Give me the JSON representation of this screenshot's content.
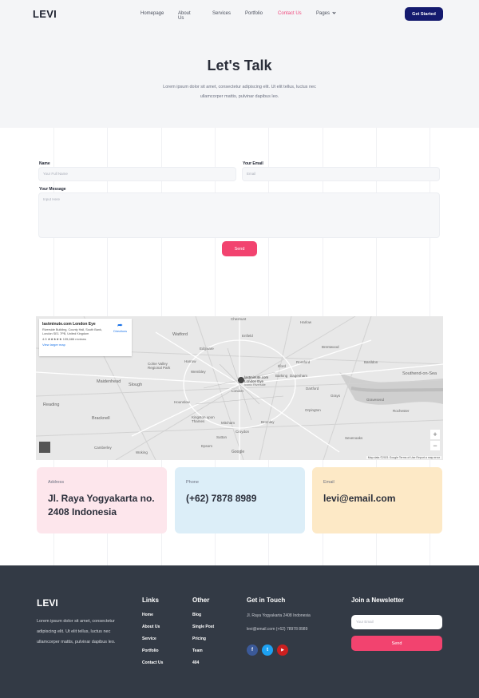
{
  "header": {
    "logo": "LEVI",
    "nav": [
      {
        "label": "Homepage"
      },
      {
        "label": "About Us"
      },
      {
        "label": "Services"
      },
      {
        "label": "Portfolio"
      },
      {
        "label": "Contact Us",
        "active": true
      },
      {
        "label": "Pages"
      }
    ],
    "cta_label": "Get Started",
    "accent": "#f0477c",
    "cta_color": "#141a6e"
  },
  "hero": {
    "title": "Let's Talk",
    "subtitle": "Lorem ipsum dolor sit amet, consectetur adipiscing elit. Ut elit tellus, luctus nec ullamcorper mattis, pulvinar dapibus leo."
  },
  "form": {
    "name_label": "Name",
    "name_placeholder": "Your Full Name",
    "email_label": "Your Email",
    "email_placeholder": "Email",
    "message_label": "Your Message",
    "message_placeholder": "Input Here",
    "send_label": "Send"
  },
  "map": {
    "place_title": "lastminute.com London Eye",
    "place_address": "Riverside Building, County Hall, South Bank, London SE1 7PB, United Kingdom",
    "rating": "4.5 ★★★★★  135,686 reviews",
    "larger_map": "View larger map",
    "directions": "Directions",
    "pin_label": "lastminute.com London Eye",
    "pin_sub": "Iconic Riverside",
    "zoom_in": "+",
    "zoom_out": "−",
    "footer_text": "Map data ©2021 Google   Terms of Use   Report a map error",
    "labels": {
      "cheshunt": "Cheshunt",
      "watford": "Watford",
      "enfield": "Enfield",
      "harlow": "Harlow",
      "brentwood": "Brentwood",
      "basildon": "Basildon",
      "southend": "Southend-on-Sea",
      "edgware": "Edgware",
      "harrow": "Harrow",
      "wembley": "Wembley",
      "colne": "Colne Valley Regional Park",
      "romford": "Romford",
      "ilford": "Ilford",
      "dagenham": "Dagenham",
      "barking": "Barking",
      "maidenhead": "Maidenhead",
      "slough": "Slough",
      "hounslow": "Hounslow",
      "london": "London",
      "dartford": "Dartford",
      "grays": "Grays",
      "reading": "Reading",
      "bracknell": "Bracknell",
      "kingston": "Kingston upon Thames",
      "mitcham": "Mitcham",
      "bromley": "Bromley",
      "croydon": "Croydon",
      "sutton": "Sutton",
      "epsom": "Epsom",
      "woking": "Woking",
      "sevenoaks": "Sevenoaks",
      "gravesend": "Gravesend",
      "rochester": "Rochester",
      "camberley": "Camberley",
      "orpington": "Orpington",
      "google": "Google"
    }
  },
  "cards": [
    {
      "key": "Address",
      "value": "Jl. Raya Yogyakarta no. 2408 Indonesia",
      "color": "#fde6ec"
    },
    {
      "key": "Phone",
      "value": "(+62) 7878 8989",
      "color": "#dceef8"
    },
    {
      "key": "Email",
      "value": "levi@email.com",
      "color": "#fde9c6"
    }
  ],
  "footer": {
    "logo": "LEVI",
    "about": "Lorem ipsum dolor sit amet, consectetur adipiscing elit. Ut elit tellus, luctus nec ullamcorper mattis, pulvinar dapibus leo.",
    "links_title": "Links",
    "links": [
      "Home",
      "About Us",
      "Service",
      "Portfolio",
      "Contact Us"
    ],
    "other_title": "Other",
    "other": [
      "Blog",
      "Single Post",
      "Pricing",
      "Team",
      "404"
    ],
    "touch_title": "Get in Touch",
    "touch_address": "Jl. Raya Yogyakarta 2408 Indonesia",
    "touch_contact": "levi@email.com (+62) 78978 8989",
    "social": [
      {
        "icon": "facebook-icon",
        "glyph": "f",
        "color": "#3b5998"
      },
      {
        "icon": "twitter-icon",
        "glyph": "t",
        "color": "#1da1f2"
      },
      {
        "icon": "youtube-icon",
        "glyph": "▶",
        "color": "#cc1f1f"
      }
    ],
    "newsletter_title": "Join a Newsletter",
    "newsletter_placeholder": "Your Email",
    "newsletter_button": "Send",
    "bg": "#333a45"
  }
}
